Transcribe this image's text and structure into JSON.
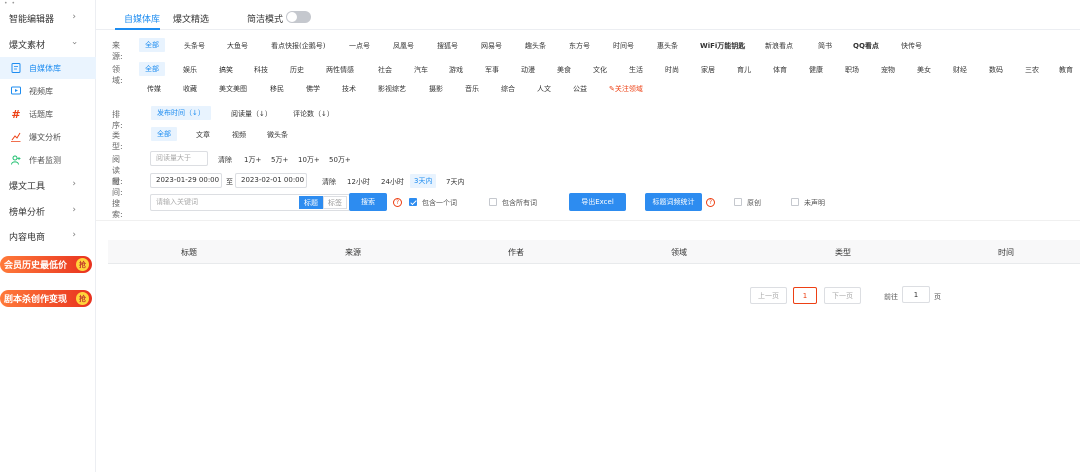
{
  "sidebar": {
    "top_dots": "•  •",
    "items": {
      "smart_editor": "智能编辑器",
      "hot_material": "爆文素材",
      "hot_tools": "爆文工具",
      "ranking": "榜单分析",
      "ecommerce": "内容电商"
    },
    "subitems": {
      "media_lib": "自媒体库",
      "video_lib": "视频库",
      "topic_lib": "话题库",
      "hot_analysis": "爆文分析",
      "author_monitor": "作者监测"
    },
    "promo1": "会员历史最低价",
    "promo2": "剧本杀创作变现",
    "promo_badge": "抢"
  },
  "tabs": {
    "media_lib": "自媒体库",
    "hot_picks": "爆文精选",
    "simple_mode": "简洁模式"
  },
  "filters": {
    "source_label": "来源:",
    "sources": [
      "全部",
      "头条号",
      "大鱼号",
      "看点快报(企鹅号)",
      "一点号",
      "凤凰号",
      "搜狐号",
      "网易号",
      "趣头条",
      "东方号",
      "时间号",
      "惠头条",
      "WiFi万能钥匙",
      "新浪看点",
      "简书",
      "QQ看点",
      "快传号"
    ],
    "field_label": "领域:",
    "fields_row1": [
      "全部",
      "娱乐",
      "搞笑",
      "科技",
      "历史",
      "两性情感",
      "社会",
      "汽车",
      "游戏",
      "军事",
      "动漫",
      "美食",
      "文化",
      "生活",
      "时尚",
      "家居",
      "育儿",
      "体育",
      "健康",
      "职场",
      "宠物",
      "美女",
      "财经",
      "数码",
      "三农",
      "教育"
    ],
    "fields_row2": [
      "传媒",
      "收藏",
      "美文美图",
      "移民",
      "佛学",
      "技术",
      "影视综艺",
      "摄影",
      "音乐",
      "综合",
      "人文",
      "公益"
    ],
    "follow_field": "关注领域",
    "sort_label": "排序:",
    "sort_options": [
      "发布时间（↓）",
      "阅读量（↓）",
      "评论数（↓）"
    ],
    "type_label": "类型:",
    "type_options": [
      "全部",
      "文章",
      "视频",
      "微头条"
    ],
    "read_label": "阅读量:",
    "read_placeholder": "阅读量大于",
    "read_options": [
      "清除",
      "1万+",
      "5万+",
      "10万+",
      "50万+"
    ],
    "time_label": "时间:",
    "date_start": "2023-01-29 00:00",
    "date_to": "至",
    "date_end": "2023-02-01 00:00",
    "time_options": [
      "清除",
      "12小时",
      "24小时",
      "3天内",
      "7天内"
    ],
    "search_label": "搜索:",
    "search_placeholder": "请输入关键词",
    "seg_title": "标题",
    "seg_tag": "标签",
    "search_button": "搜索",
    "contains_one": "包含一个词",
    "contains_all": "包含所有词",
    "export_button": "导出Excel",
    "title_stats_button": "标题词频统计",
    "original": "原创",
    "undeclared": "未声明"
  },
  "table": {
    "columns": [
      "标题",
      "来源",
      "作者",
      "领域",
      "类型",
      "时间"
    ]
  },
  "pager": {
    "prev": "上一页",
    "current": "1",
    "next": "下一页",
    "goto_label": "前往",
    "goto_value": "1",
    "page_unit": "页"
  },
  "colors": {
    "primary": "#2d8cf0",
    "danger": "#ed4014",
    "promo": "#e8321f"
  }
}
